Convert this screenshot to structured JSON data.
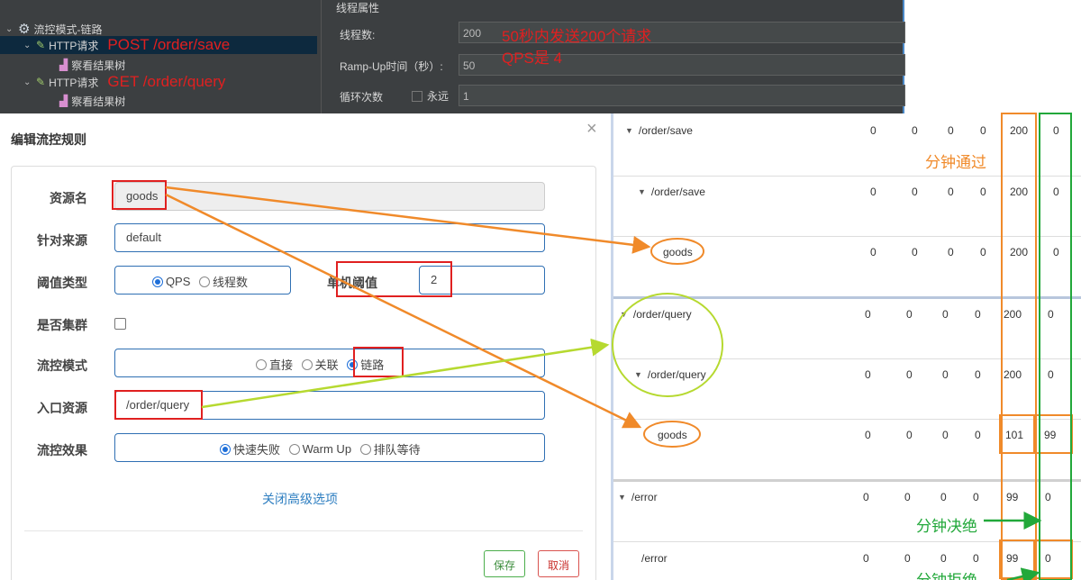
{
  "jmeter": {
    "tree": [
      {
        "label": "流控模式-链路"
      },
      {
        "label": "HTTP请求",
        "annotation": "POST  /order/save"
      },
      {
        "label": "察看结果树"
      },
      {
        "label": "HTTP请求",
        "annotation": "GET    /order/query"
      },
      {
        "label": "察看结果树"
      }
    ],
    "props": {
      "section_title": "线程属性",
      "threads_label": "线程数:",
      "threads_value": "200",
      "rampup_label": "Ramp-Up时间（秒）:",
      "rampup_value": "50",
      "loop_label": "循环次数",
      "forever_label": "永远",
      "loop_value": "1",
      "annotation_line1": "50秒内发送200个请求",
      "annotation_line2": "QPS是 4"
    }
  },
  "dialog": {
    "title": "编辑流控规则",
    "close": "×",
    "resource_label": "资源名",
    "resource_value": "goods",
    "source_label": "针对来源",
    "source_value": "default",
    "threshold_type_label": "阈值类型",
    "threshold_type_options": [
      "QPS",
      "线程数"
    ],
    "threshold_type_selected": "QPS",
    "single_threshold_label": "单机阈值",
    "single_threshold_value": "2",
    "cluster_label": "是否集群",
    "mode_label": "流控模式",
    "mode_options": [
      "直接",
      "关联",
      "链路"
    ],
    "mode_selected": "链路",
    "entry_label": "入口资源",
    "entry_value": "/order/query",
    "effect_label": "流控效果",
    "effect_options": [
      "快速失败",
      "Warm Up",
      "排队等待"
    ],
    "effect_selected": "快速失败",
    "advanced_link": "关闭高级选项",
    "save_button": "保存",
    "cancel_button": "取消"
  },
  "stats": {
    "rows": [
      {
        "name": "/order/save",
        "vals": [
          "0",
          "0",
          "0",
          "0",
          "200",
          "0"
        ]
      },
      {
        "name": "/order/save",
        "vals": [
          "0",
          "0",
          "0",
          "0",
          "200",
          "0"
        ]
      },
      {
        "name": "goods",
        "vals": [
          "0",
          "0",
          "0",
          "0",
          "200",
          "0"
        ]
      },
      {
        "name": "/order/query",
        "vals": [
          "0",
          "0",
          "0",
          "0",
          "200",
          "0"
        ]
      },
      {
        "name": "/order/query",
        "vals": [
          "0",
          "0",
          "0",
          "0",
          "200",
          "0"
        ]
      },
      {
        "name": "goods",
        "vals": [
          "0",
          "0",
          "0",
          "0",
          "101",
          "99"
        ]
      },
      {
        "name": "/error",
        "vals": [
          "0",
          "0",
          "0",
          "0",
          "99",
          "0"
        ]
      },
      {
        "name": "/error",
        "vals": [
          "0",
          "0",
          "0",
          "0",
          "99",
          "0"
        ]
      }
    ],
    "annotation_pass": "分钟通过",
    "annotation_block": "分钟决绝",
    "annotation_block_cut": "分钟拒绝"
  },
  "colors": {
    "orange": "#f08a2a",
    "green": "#22a83a",
    "lime": "#b6d930",
    "red": "#e02020",
    "blue": "#2f6fb3"
  }
}
